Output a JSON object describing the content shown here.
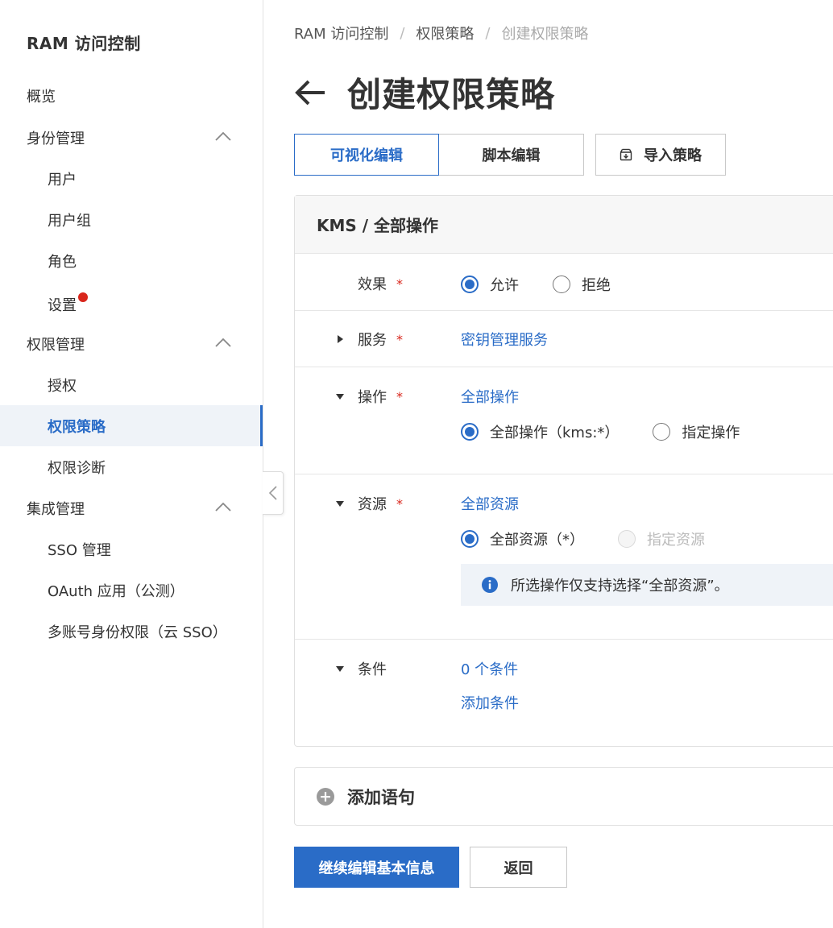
{
  "sidebar": {
    "title": "RAM 访问控制",
    "items": [
      {
        "label": "概览"
      },
      {
        "label": "身份管理"
      },
      {
        "label": "用户"
      },
      {
        "label": "用户组"
      },
      {
        "label": "角色"
      },
      {
        "label": "设置"
      },
      {
        "label": "权限管理"
      },
      {
        "label": "授权"
      },
      {
        "label": "权限策略"
      },
      {
        "label": "权限诊断"
      },
      {
        "label": "集成管理"
      },
      {
        "label": "SSO 管理"
      },
      {
        "label": "OAuth 应用（公测）"
      },
      {
        "label": "多账号身份权限（云 SSO）"
      }
    ]
  },
  "breadcrumb": {
    "items": [
      "RAM 访问控制",
      "权限策略",
      "创建权限策略"
    ],
    "separator": "/"
  },
  "page": {
    "title": "创建权限策略"
  },
  "tabs": {
    "visual": "可视化编辑",
    "script": "脚本编辑"
  },
  "import_label": "导入策略",
  "statement": {
    "header": "KMS / 全部操作",
    "effect": {
      "label": "效果",
      "required": "*",
      "allow": "允许",
      "deny": "拒绝",
      "selected": "允许"
    },
    "service": {
      "label": "服务",
      "required": "*",
      "value": "密钥管理服务"
    },
    "action": {
      "label": "操作",
      "required": "*",
      "summary": "全部操作",
      "all": "全部操作（kms:*）",
      "specific": "指定操作",
      "selected": "全部操作（kms:*）"
    },
    "resource": {
      "label": "资源",
      "required": "*",
      "summary": "全部资源",
      "all": "全部资源（*）",
      "specific": "指定资源",
      "selected": "全部资源（*）",
      "info": "所选操作仅支持选择“全部资源”。"
    },
    "condition": {
      "label": "条件",
      "summary": "0 个条件",
      "add": "添加条件"
    }
  },
  "add_statement": "添加语句",
  "footer": {
    "continue": "继续编辑基本信息",
    "back": "返回"
  },
  "colors": {
    "accent": "#2a6cc7",
    "required": "#d9261c",
    "badge": "#d9261c"
  }
}
